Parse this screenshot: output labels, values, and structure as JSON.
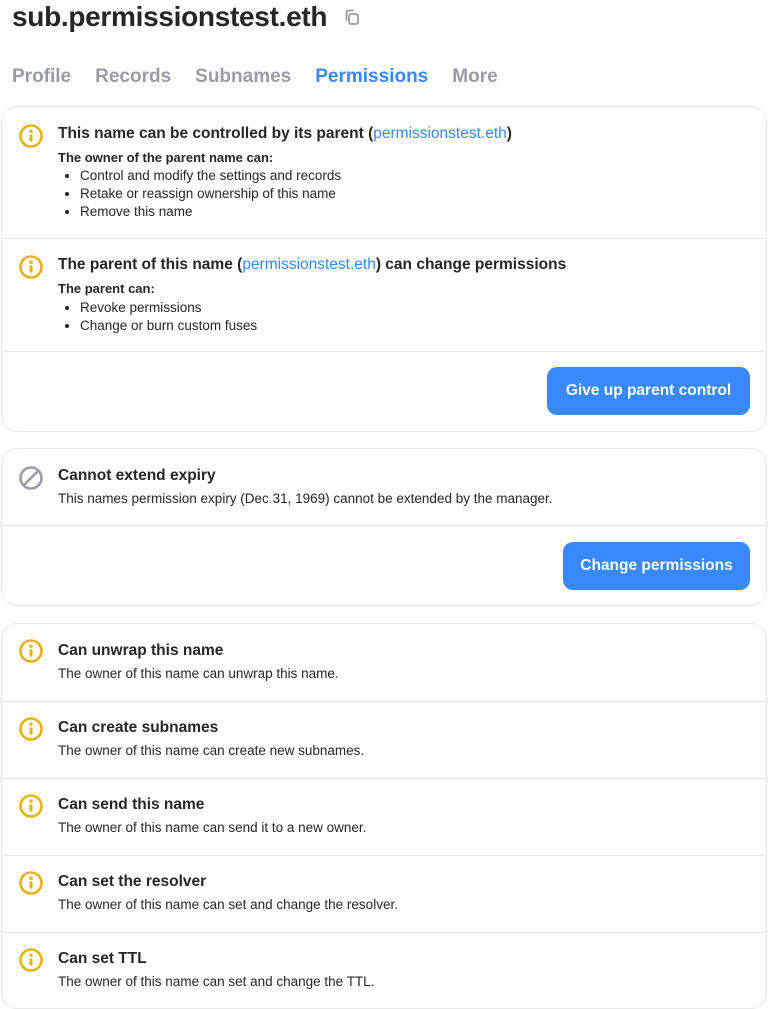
{
  "header": {
    "title": "sub.permissionstest.eth",
    "copy_icon": "copy-icon"
  },
  "tabs": [
    {
      "label": "Profile",
      "active": false
    },
    {
      "label": "Records",
      "active": false
    },
    {
      "label": "Subnames",
      "active": false
    },
    {
      "label": "Permissions",
      "active": true
    },
    {
      "label": "More",
      "active": false
    }
  ],
  "colors": {
    "accent": "#3889ff",
    "warning_icon": "#e5b30f",
    "disabled_icon": "#9b9ba6",
    "tab_inactive": "#9b9ba6"
  },
  "parent_card": {
    "control": {
      "icon": "info-icon",
      "heading_prefix": "This name can be controlled by its parent (",
      "heading_link": "permissionstest.eth",
      "heading_suffix": ")",
      "subheading": "The owner of the parent name can:",
      "items": [
        "Control and modify the settings and records",
        "Retake or reassign ownership of this name",
        "Remove this name"
      ]
    },
    "permissions": {
      "icon": "info-icon",
      "heading_prefix": "The parent of this name (",
      "heading_link": "permissionstest.eth",
      "heading_suffix": ") can change permissions",
      "subheading": "The parent can:",
      "items": [
        "Revoke permissions",
        "Change or burn custom fuses"
      ]
    },
    "button_label": "Give up parent control"
  },
  "expiry_card": {
    "icon": "disabled-icon",
    "heading": "Cannot extend expiry",
    "description": "This names permission expiry (Dec 31, 1969) cannot be extended by the manager.",
    "button_label": "Change permissions"
  },
  "abilities_card": {
    "items": [
      {
        "icon": "info-icon",
        "heading": "Can unwrap this name",
        "description": "The owner of this name can unwrap this name."
      },
      {
        "icon": "info-icon",
        "heading": "Can create subnames",
        "description": "The owner of this name can create new subnames."
      },
      {
        "icon": "info-icon",
        "heading": "Can send this name",
        "description": "The owner of this name can send it to a new owner."
      },
      {
        "icon": "info-icon",
        "heading": "Can set the resolver",
        "description": "The owner of this name can set and change the resolver."
      },
      {
        "icon": "info-icon",
        "heading": "Can set TTL",
        "description": "The owner of this name can set and change the TTL."
      }
    ]
  }
}
